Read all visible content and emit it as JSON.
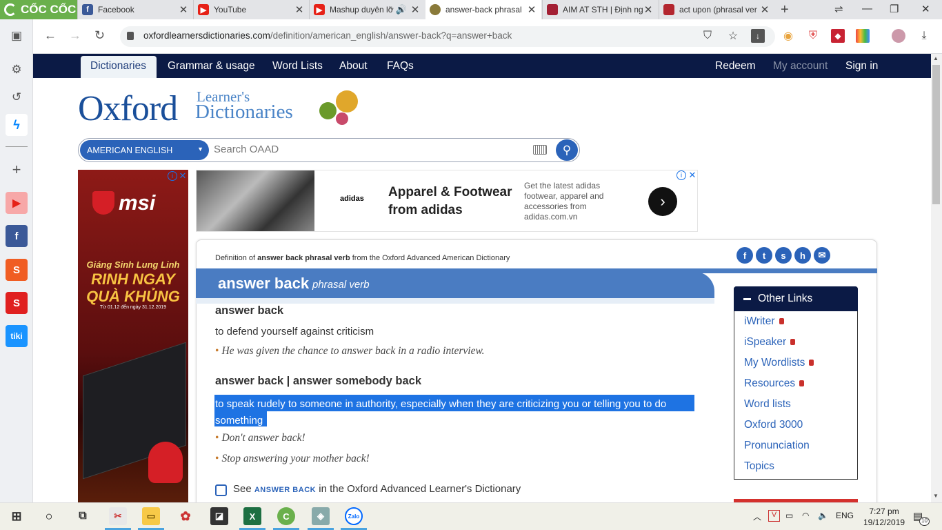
{
  "browser": {
    "brand": "CỐC CỐC",
    "tabs": [
      {
        "title": "Facebook",
        "icon": "facebook-icon"
      },
      {
        "title": "YouTube",
        "icon": "youtube-icon"
      },
      {
        "title": "Mashup duyên lỡ",
        "icon": "youtube-icon"
      },
      {
        "title": "answer-back phrasal",
        "icon": "oxford-icon",
        "active": true
      },
      {
        "title": "AIM AT STH | Định ng",
        "icon": "cambridge-icon"
      },
      {
        "title": "act upon (phrasal ver",
        "icon": "book-icon"
      }
    ],
    "url_host": "oxfordlearnersdictionaries.com",
    "url_path": "/definition/american_english/answer-back?q=answer+back"
  },
  "site": {
    "nav": [
      "Dictionaries",
      "Grammar & usage",
      "Word Lists",
      "About",
      "FAQs"
    ],
    "nav_right": [
      "Redeem",
      "My account",
      "Sign in"
    ],
    "logo_main": "Oxford",
    "logo_sub1": "Learner's",
    "logo_sub2": "Dictionaries",
    "dialect": "AMERICAN ENGLISH",
    "search_placeholder": "Search OAAD"
  },
  "ads": {
    "left_brand": "msi",
    "left_line1": "Giáng Sinh Lung Linh",
    "left_line2": "RINH NGAY QUÀ KHỦNG",
    "left_line3": "Từ 01.12 đến ngày 31.12.2019",
    "top_brand": "adidas",
    "top_heading": "Apparel & Footwear from adidas",
    "top_text": "Get the latest adidas footwear, apparel and accessories from adidas.com.vn"
  },
  "entry": {
    "source_pre": "Definition of ",
    "source_bold": "answer back phrasal verb",
    "source_post": " from the Oxford Advanced American Dictionary",
    "headword": "answer back",
    "pos": "phrasal verb",
    "sense1_head": "answer back",
    "sense1_def": "to defend yourself against criticism",
    "sense1_ex": "He was given the chance to answer back in a radio interview.",
    "sense2_head": "answer back | answer somebody back",
    "sense2_def": "to speak rudely to someone in authority, especially when they are criticizing you or telling you to do something",
    "sense2_ex1": "Don't answer back!",
    "sense2_ex2": "Stop answering your mother back!",
    "see_pre": "See ",
    "see_link": "ANSWER BACK",
    "see_post": " in the Oxford Advanced Learner's Dictionary"
  },
  "other_links": {
    "title": "Other Links",
    "items": [
      "iWriter",
      "iSpeaker",
      "My Wordlists",
      "Resources",
      "Word lists",
      "Oxford 3000",
      "Pronunciation",
      "Topics"
    ]
  },
  "taskbar": {
    "lang": "ENG",
    "time": "7:27 pm",
    "date": "19/12/2019",
    "notif_count": "10"
  }
}
